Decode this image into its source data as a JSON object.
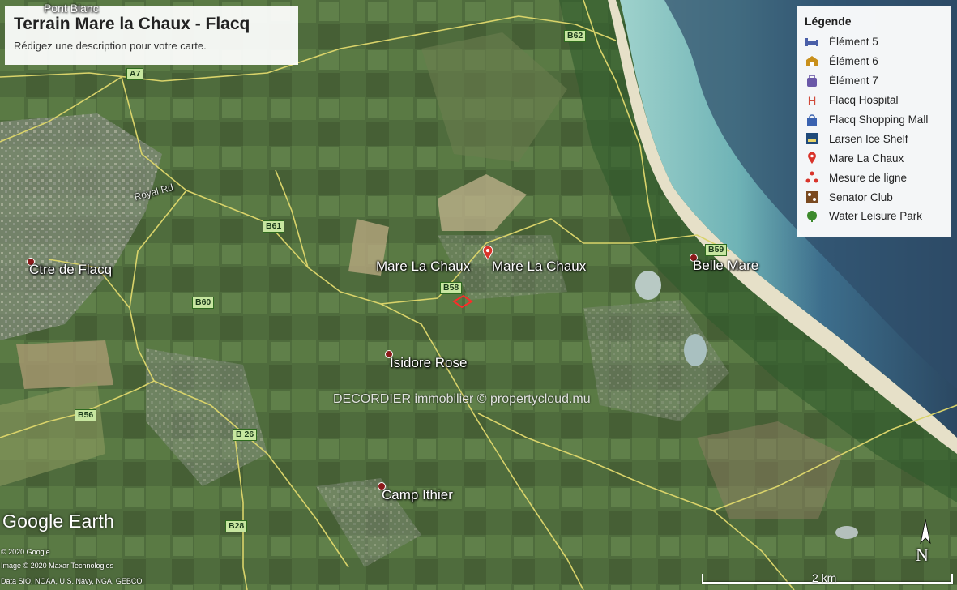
{
  "map": {
    "title": "Terrain Mare la Chaux - Flacq",
    "description": "Rédigez une description pour votre carte.",
    "watermark": "DECORDIER immobilier © propertycloud.mu",
    "faint_label": "Pont Blanc"
  },
  "legend": {
    "title": "Légende",
    "items": [
      {
        "label": "Élément 5",
        "icon": "bed-icon",
        "color": "#4a5fa8"
      },
      {
        "label": "Élément 6",
        "icon": "lodging-icon",
        "color": "#c9901c"
      },
      {
        "label": "Élément 7",
        "icon": "luggage-icon",
        "color": "#6a58a8"
      },
      {
        "label": "Flacq Hospital",
        "icon": "hospital-icon",
        "color": "#d04a3a"
      },
      {
        "label": "Flacq Shopping Mall",
        "icon": "shopping-bag-icon",
        "color": "#3a62b0"
      },
      {
        "label": "Larsen Ice Shelf",
        "icon": "ice-shelf-icon",
        "color": "#204a7a"
      },
      {
        "label": "Mare La Chaux",
        "icon": "pin-icon",
        "color": "#d9342b"
      },
      {
        "label": "Mesure de ligne",
        "icon": "line-measure-icon",
        "color": "#d9342b"
      },
      {
        "label": "Senator Club",
        "icon": "club-icon",
        "color": "#7a4a20"
      },
      {
        "label": "Water Leisure Park",
        "icon": "park-icon",
        "color": "#3c8a2c"
      }
    ]
  },
  "places": {
    "ctre_de_flacq": "Ctre de Flacq",
    "mare_la_chaux_1": "Mare La Chaux",
    "mare_la_chaux_2": "Mare La Chaux",
    "belle_mare": "Belle Mare",
    "isidore_rose": "Isidore Rose",
    "camp_ithier": "Camp Ithier",
    "royal_rd": "Royal Rd"
  },
  "roads": {
    "a7": "A7",
    "b62": "B62",
    "b61": "B61",
    "b59": "B59",
    "b58": "B58",
    "b60": "B60",
    "b56": "B56",
    "b26": "B 26",
    "b28": "B28"
  },
  "footer": {
    "logo": "Google Earth",
    "credit1": "© 2020 Google",
    "credit2": "Image © 2020 Maxar Technologies",
    "credit3": "Data SIO, NOAA, U.S. Navy, NGA, GEBCO",
    "scale": "2 km",
    "north": "N"
  },
  "colors": {
    "road": "#d9d36a",
    "pin": "#d9342b",
    "ocean_deep": "#2d4c68",
    "lagoon": "#8fc6c4",
    "land": "#4c6b3c"
  }
}
